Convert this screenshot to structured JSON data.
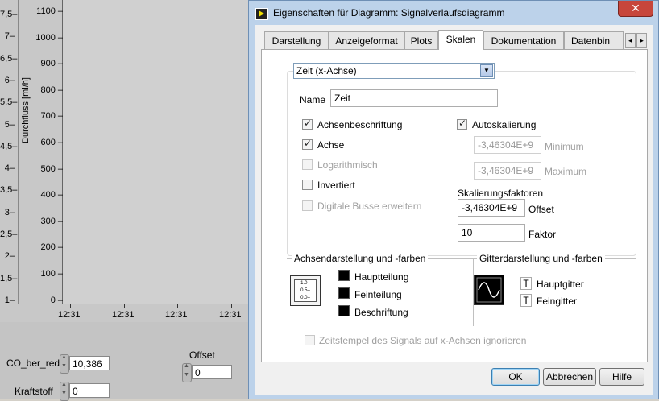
{
  "background": {
    "chart": {
      "y_axis_label": "Durchfluss [ml/h]",
      "y_ticks": [
        "1100",
        "1000",
        "900",
        "800",
        "700",
        "600",
        "500",
        "400",
        "300",
        "200",
        "100",
        "0"
      ],
      "left_axis_ticks": [
        "7,5",
        "7",
        "6,5",
        "6",
        "5,5",
        "5",
        "4,5",
        "4",
        "3,5",
        "3",
        "2,5",
        "2",
        "1,5",
        "1"
      ],
      "left_axis_suffix": "–",
      "x_ticks": [
        "12:31",
        "12:31",
        "12:31",
        "12:31"
      ]
    },
    "controls": {
      "co_label": "CO_ber_red",
      "co_value": "10,386",
      "offset_label": "Offset",
      "offset_value": "0",
      "kraftstoff_label": "Kraftstoff",
      "kraftstoff_value": "0"
    }
  },
  "dialog": {
    "title": "Eigenschaften für Diagramm: Signalverlaufsdiagramm",
    "close_symbol": "✕",
    "tabs": [
      {
        "label": "Darstellung",
        "active": false
      },
      {
        "label": "Anzeigeformat",
        "active": false
      },
      {
        "label": "Plots",
        "active": false
      },
      {
        "label": "Skalen",
        "active": true
      },
      {
        "label": "Dokumentation",
        "active": false
      },
      {
        "label": "Datenbin",
        "active": false
      }
    ],
    "tab_scroll_left": "◄",
    "tab_scroll_right": "►",
    "axis_select": {
      "value": "Zeit (x-Achse)",
      "arrow": "▼"
    },
    "name_label": "Name",
    "name_value": "Zeit",
    "checkboxes_left": [
      {
        "label": "Achsenbeschriftung",
        "checked": true,
        "enabled": true
      },
      {
        "label": "Achse",
        "checked": true,
        "enabled": true
      },
      {
        "label": "Logarithmisch",
        "checked": false,
        "enabled": false
      },
      {
        "label": "Invertiert",
        "checked": false,
        "enabled": true
      },
      {
        "label": "Digitale Busse erweitern",
        "checked": false,
        "enabled": false
      }
    ],
    "autoscale": {
      "label": "Autoskalierung",
      "checked": true
    },
    "minimum": {
      "value": "-3,46304E+9",
      "label": "Minimum"
    },
    "maximum": {
      "value": "-3,46304E+9",
      "label": "Maximum"
    },
    "scaling": {
      "title": "Skalierungsfaktoren",
      "offset_value": "-3,46304E+9",
      "offset_label": "Offset",
      "factor_value": "10",
      "factor_label": "Faktor"
    },
    "axis_style": {
      "title": "Achsendarstellung und -farben",
      "icon_text": [
        "1.0–",
        "0.5–",
        "0.0–"
      ],
      "items": [
        "Hauptteilung",
        "Feinteilung",
        "Beschriftung"
      ]
    },
    "grid_style": {
      "title": "Gitterdarstellung und -farben",
      "items": [
        {
          "label": "Hauptgitter",
          "symbol": "T"
        },
        {
          "label": "Feingitter",
          "symbol": "T"
        }
      ]
    },
    "ignore_timestamp": {
      "label": "Zeitstempel des Signals auf x-Achsen ignorieren",
      "checked": false,
      "enabled": false
    },
    "buttons": {
      "ok": "OK",
      "cancel": "Abbrechen",
      "help": "Hilfe"
    }
  }
}
